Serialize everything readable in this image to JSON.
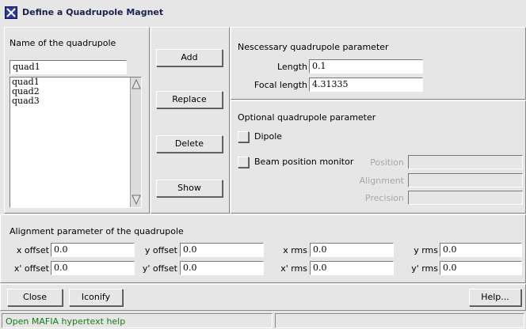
{
  "window": {
    "title": "Define a Quadrupole Magnet"
  },
  "name_panel": {
    "heading": "Name of the quadrupole",
    "name_value": "quad1",
    "list_items": [
      "quad1",
      "quad2",
      "quad3"
    ]
  },
  "actions": {
    "add": "Add",
    "replace": "Replace",
    "delete": "Delete",
    "show": "Show"
  },
  "necessary": {
    "heading": "Nescessary quadrupole parameter",
    "length_label": "Length",
    "length_value": "0.1",
    "focal_label": "Focal length",
    "focal_value": "4.31335"
  },
  "optional": {
    "heading": "Optional quadrupole parameter",
    "dipole_label": "Dipole",
    "bpm_label": "Beam position monitor",
    "position_label": "Position",
    "alignment_label": "Alignment",
    "precision_label": "Precision"
  },
  "alignment": {
    "heading": "Alignment parameter of the quadrupole",
    "x_offset_label": "x offset",
    "x_offset_value": "0.0",
    "y_offset_label": "y offset",
    "y_offset_value": "0.0",
    "x_rms_label": "x rms",
    "x_rms_value": "0.0",
    "y_rms_label": "y rms",
    "y_rms_value": "0.0",
    "xp_offset_label": "x' offset",
    "xp_offset_value": "0.0",
    "yp_offset_label": "y' offset",
    "yp_offset_value": "0.0",
    "xp_rms_label": "x' rms",
    "xp_rms_value": "0.0",
    "yp_rms_label": "y' rms",
    "yp_rms_value": "0.0"
  },
  "bottom": {
    "close": "Close",
    "iconify": "Iconify",
    "help": "Help..."
  },
  "status": {
    "text": "Open MAFIA hypertext help"
  }
}
